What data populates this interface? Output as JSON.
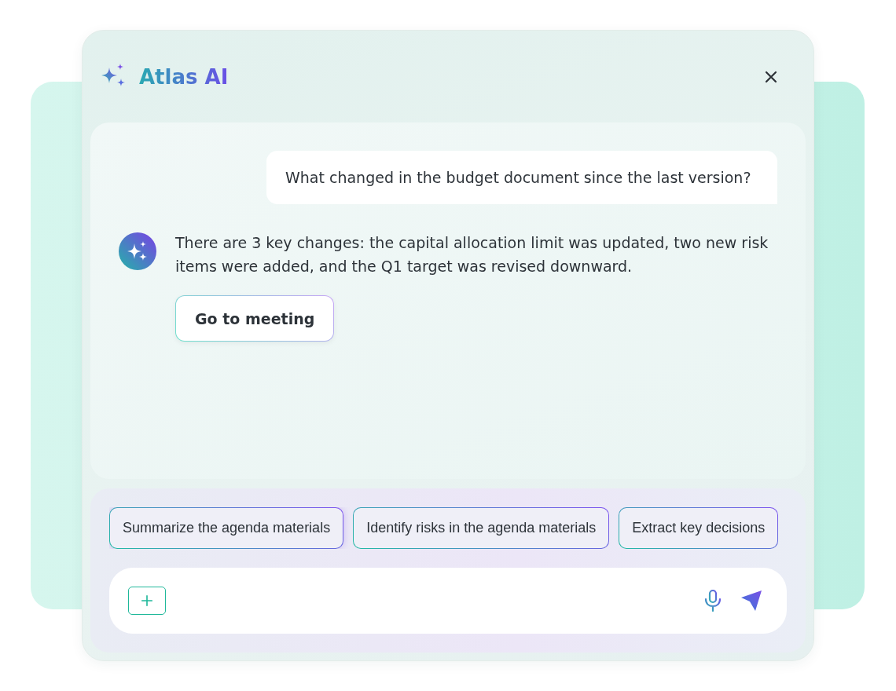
{
  "header": {
    "title": "Atlas AI"
  },
  "messages": [
    {
      "kind": "user",
      "text": "What changed in the budget document since the last version?"
    },
    {
      "kind": "assistant",
      "text": "There are 3 key changes: the capital allocation limit was updated, two new risk items were added, and the Q1 target was revised downward.",
      "action": "Go to meeting"
    }
  ],
  "suggestions": [
    {
      "label": "Summarize the agenda materials",
      "selected": true
    },
    {
      "label": "Identify risks in the agenda materials",
      "selected": false
    },
    {
      "label": "Extract key decisions",
      "selected": false
    }
  ]
}
